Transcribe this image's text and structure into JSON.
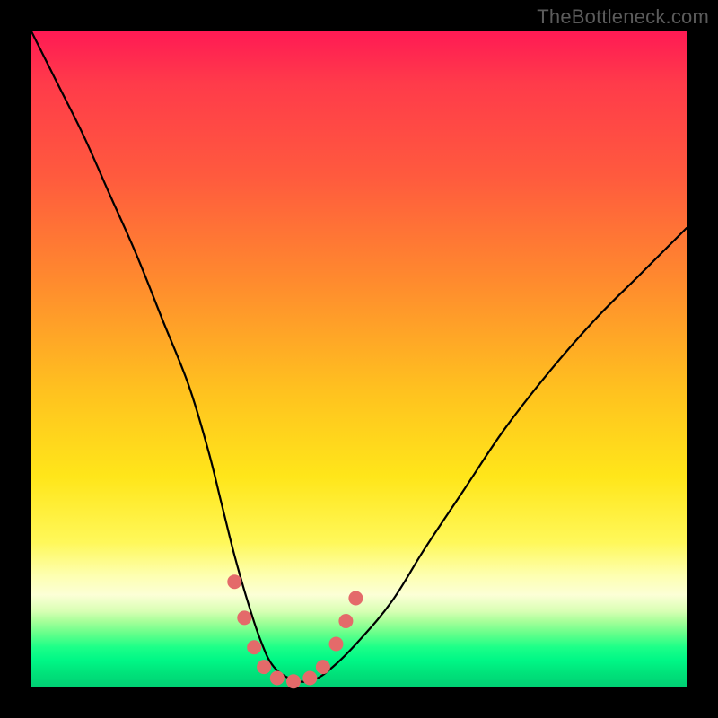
{
  "watermark": "TheBottleneck.com",
  "chart_data": {
    "type": "line",
    "title": "",
    "xlabel": "",
    "ylabel": "",
    "xlim": [
      0,
      100
    ],
    "ylim": [
      0,
      100
    ],
    "gradient_stops": [
      {
        "pct": 0,
        "color": "#ff1a54"
      },
      {
        "pct": 22,
        "color": "#ff5a3e"
      },
      {
        "pct": 55,
        "color": "#ffc21f"
      },
      {
        "pct": 78,
        "color": "#fff85a"
      },
      {
        "pct": 88,
        "color": "#d8ffb4"
      },
      {
        "pct": 100,
        "color": "#00d074"
      }
    ],
    "series": [
      {
        "name": "bottleneck-curve",
        "x": [
          0,
          4,
          8,
          12,
          16,
          20,
          24,
          27,
          29,
          31,
          33,
          35,
          37,
          40,
          43,
          46,
          50,
          55,
          60,
          66,
          72,
          79,
          86,
          93,
          100
        ],
        "y": [
          100,
          92,
          84,
          75,
          66,
          56,
          46,
          36,
          28,
          20,
          13,
          7,
          3,
          1,
          1,
          3,
          7,
          13,
          21,
          30,
          39,
          48,
          56,
          63,
          70
        ]
      }
    ],
    "markers": [
      {
        "x": 31.0,
        "y": 16.0
      },
      {
        "x": 32.5,
        "y": 10.5
      },
      {
        "x": 34.0,
        "y": 6.0
      },
      {
        "x": 35.5,
        "y": 3.0
      },
      {
        "x": 37.5,
        "y": 1.3
      },
      {
        "x": 40.0,
        "y": 0.8
      },
      {
        "x": 42.5,
        "y": 1.3
      },
      {
        "x": 44.5,
        "y": 3.0
      },
      {
        "x": 46.5,
        "y": 6.5
      },
      {
        "x": 48.0,
        "y": 10.0
      },
      {
        "x": 49.5,
        "y": 13.5
      }
    ],
    "marker_color": "#e46a6a",
    "marker_radius_px": 8,
    "curve_stroke": "#000000"
  }
}
